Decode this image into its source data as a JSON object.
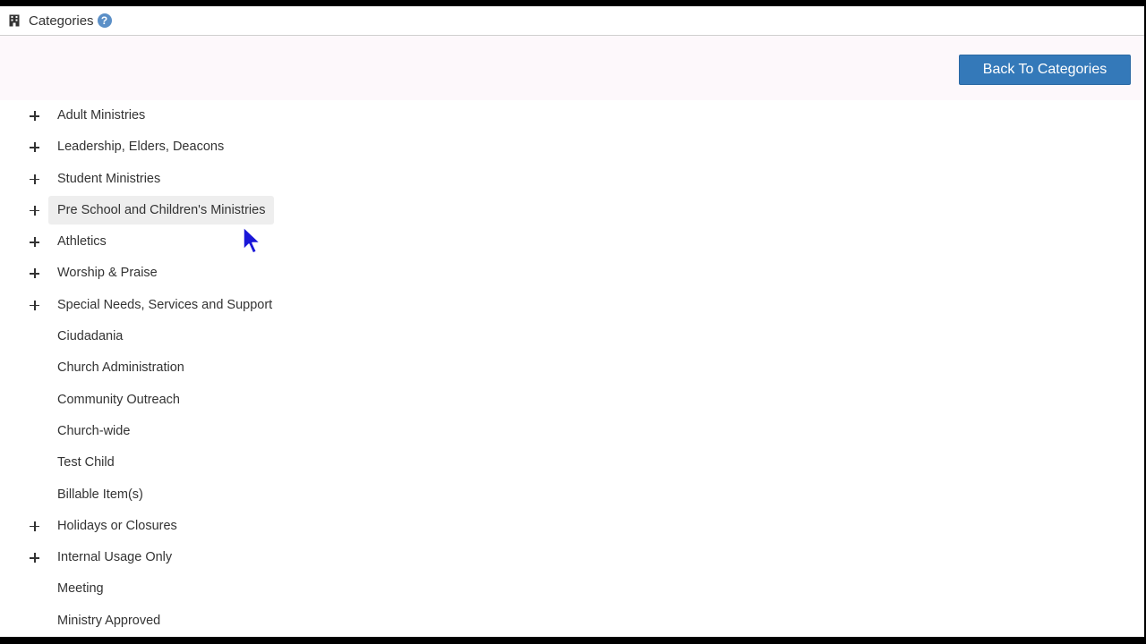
{
  "header": {
    "title": "Categories",
    "help_glyph": "?",
    "title_icon": "building-icon",
    "help_icon": "help-circle-icon"
  },
  "toolbar": {
    "back_label": "Back To Categories",
    "accent_color": "#3479b9"
  },
  "categories": [
    {
      "label": "Adult Ministries",
      "expandable": true
    },
    {
      "label": "Leadership, Elders, Deacons",
      "expandable": true
    },
    {
      "label": "Student Ministries",
      "expandable": true
    },
    {
      "label": "Pre School and Children's Ministries",
      "expandable": true,
      "hovered": true
    },
    {
      "label": "Athletics",
      "expandable": true
    },
    {
      "label": "Worship & Praise",
      "expandable": true
    },
    {
      "label": "Special Needs, Services and Support",
      "expandable": true
    },
    {
      "label": "Ciudadania",
      "expandable": false
    },
    {
      "label": "Church Administration",
      "expandable": false
    },
    {
      "label": "Community Outreach",
      "expandable": false
    },
    {
      "label": "Church-wide",
      "expandable": false
    },
    {
      "label": "Test Child",
      "expandable": false
    },
    {
      "label": "Billable Item(s)",
      "expandable": false
    },
    {
      "label": "Holidays or Closures",
      "expandable": true
    },
    {
      "label": "Internal Usage Only",
      "expandable": true
    },
    {
      "label": "Meeting",
      "expandable": false
    },
    {
      "label": "Ministry Approved",
      "expandable": false
    }
  ]
}
